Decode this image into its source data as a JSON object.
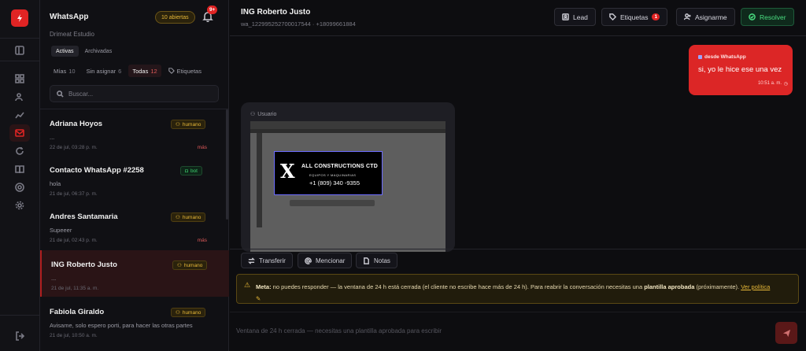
{
  "sidebar": {
    "title": "WhatsApp",
    "subtitle": "Drimeat Estudio",
    "open_badge": "10 abiertas",
    "notif_count": "9+",
    "view_tabs": [
      "Activas",
      "Archivadas"
    ],
    "filters": [
      {
        "label": "Mías",
        "count": "10"
      },
      {
        "label": "Sin asignar",
        "count": "6"
      },
      {
        "label": "Todas",
        "count": "12"
      }
    ],
    "tags_filter": "Etiquetas",
    "search_placeholder": "Buscar...",
    "conversations": [
      {
        "name": "Adriana Hoyos",
        "snippet": "...",
        "time": "22 de jul, 03:28 p. m.",
        "tag": "humano",
        "extra": "más"
      },
      {
        "name": "Contacto WhatsApp #2258",
        "snippet": "hola",
        "time": "21 de jul, 06:37 p. m.",
        "tag": "bot",
        "extra": ""
      },
      {
        "name": "Andres Santamaria",
        "snippet": "Supeeer",
        "time": "21 de jul, 02:43 p. m.",
        "tag": "humano",
        "extra": "más"
      },
      {
        "name": "ING Roberto Justo",
        "snippet": "...",
        "time": "21 de jul, 11:35 a. m.",
        "tag": "humano",
        "extra": ""
      },
      {
        "name": "Fabiola Giraldo",
        "snippet": "Avisame, solo espero porti, para hacer las otras partes",
        "time": "21 de jul, 10:50 a. m.",
        "tag": "humano",
        "extra": ""
      }
    ]
  },
  "header": {
    "name": "ING Roberto Justo",
    "sub": "wa_122995252700017544 · +18099661884",
    "lead": "Lead",
    "tags": "Etiquetas",
    "tags_count": "1",
    "assign": "Asignarme",
    "resolve": "Resolver"
  },
  "messages": {
    "outgoing": {
      "source": "desde WhatsApp",
      "text": "si, yo le hice ese una vez",
      "time": "10:51 a. m."
    },
    "incoming": {
      "author": "Usuario",
      "image_text": {
        "title": "ALL CONSTRUCTIONS CTD",
        "subtitle": "EQUIPOS Y MAQUINARIAS",
        "phone": "+1 (809) 340 -9355",
        "mark": "X"
      }
    }
  },
  "composer": {
    "transfer": "Transferir",
    "mention": "Mencionar",
    "notes": "Notas",
    "warning_label": "Meta:",
    "warning_text": " no puedes responder — la ventana de 24 h está cerrada (el cliente no escribe hace más de 24 h). Para reabrir la conversación necesitas una ",
    "warning_bold": "plantilla aprobada",
    "warning_tail": " (próximamente). ",
    "warning_link": "Ver política",
    "input_placeholder": "Ventana de 24 h cerrada — necesitas una plantilla aprobada para escribir"
  },
  "colors": {
    "accent": "#dc2626",
    "warning": "#e8b938",
    "success": "#4ade80"
  }
}
